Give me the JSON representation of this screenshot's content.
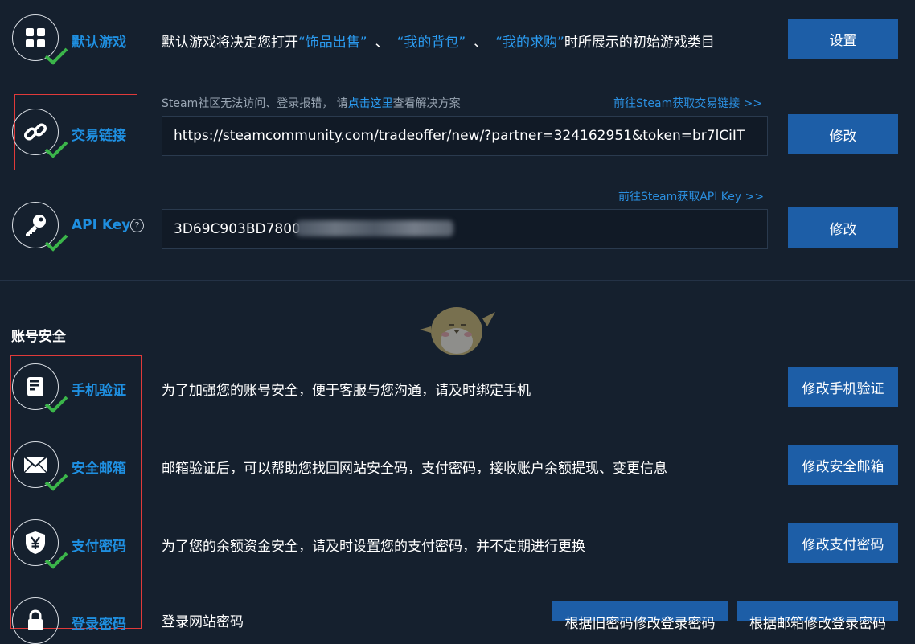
{
  "default_game": {
    "label": "默认游戏",
    "desc_prefix": "默认游戏将决定您打开",
    "q1": "“饰品出售”",
    "sep1": "、",
    "q2": "“我的背包”",
    "sep2": "、",
    "q3": "“我的求购”",
    "desc_suffix": "时所展示的初始游戏类目",
    "button": "设置"
  },
  "trade_link": {
    "label": "交易链接",
    "hint_prefix": "Steam社区无法访问、登录报错， 请",
    "hint_link": "点击这里",
    "hint_suffix": "查看解决方案",
    "top_link": "前往Steam获取交易链接 >>",
    "value": "https://steamcommunity.com/tradeoffer/new/?partner=324162951&token=br7lCiIT",
    "button": "修改"
  },
  "api_key": {
    "label": "API Key",
    "help_icon": "?",
    "top_link": "前往Steam获取API Key >>",
    "value": "3D69C903BD7800",
    "button": "修改"
  },
  "security": {
    "title": "账号安全",
    "phone": {
      "label": "手机验证",
      "desc": "为了加强您的账号安全，便于客服与您沟通，请及时绑定手机",
      "button": "修改手机验证"
    },
    "email": {
      "label": "安全邮箱",
      "desc": "邮箱验证后，可以帮助您找回网站安全码，支付密码，接收账户余额提现、变更信息",
      "button": "修改安全邮箱"
    },
    "pay": {
      "label": "支付密码",
      "desc": "为了您的余额资金安全，请及时设置您的支付密码，并不定期进行更换",
      "button": "修改支付密码"
    },
    "login": {
      "label": "登录密码",
      "desc": "登录网站密码",
      "button1": "根据旧密码修改登录密码",
      "button2": "根据邮箱修改登录密码"
    }
  },
  "icons": [
    "grid-icon",
    "link-icon",
    "key-icon",
    "phone-icon",
    "mail-icon",
    "yen-shield-icon",
    "lock-icon",
    "check-icon",
    "help-icon"
  ],
  "colors": {
    "background": "#15202e",
    "accent": "#1f8fe0",
    "button": "#1d5ea7",
    "check": "#3bb54a",
    "highlight_box": "#e03a3a"
  }
}
